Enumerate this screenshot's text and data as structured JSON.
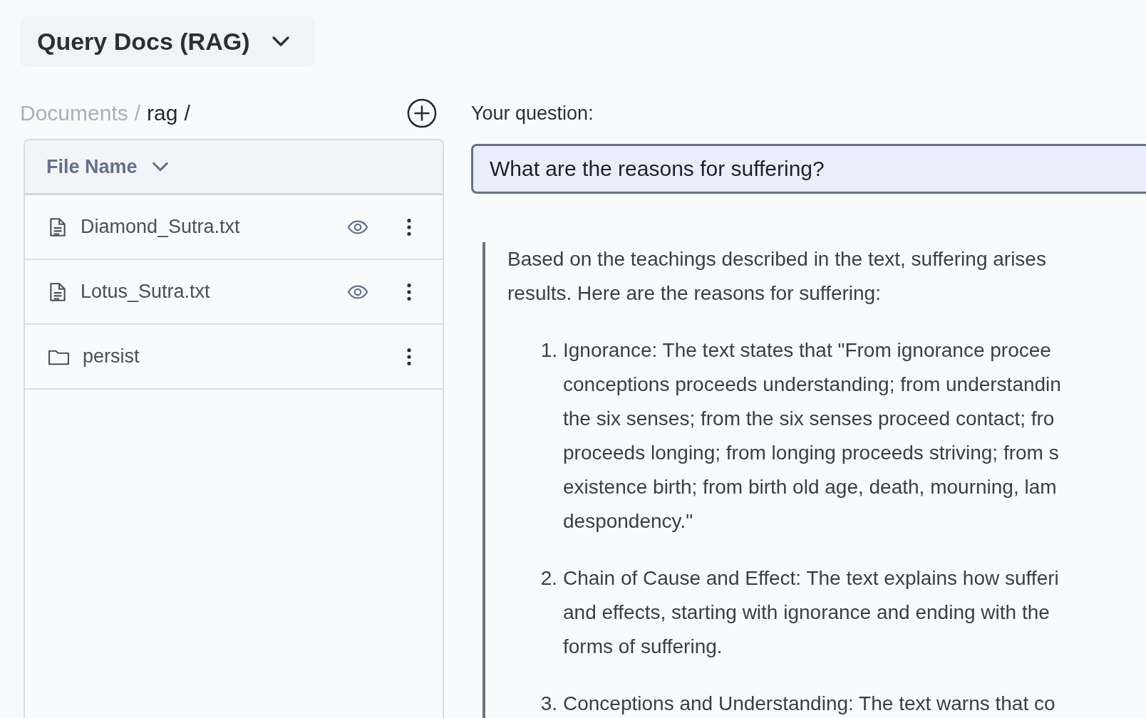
{
  "mode_selector": {
    "label": "Query Docs (RAG)"
  },
  "breadcrumb": {
    "separator": "/",
    "segments": [
      {
        "label": "Documents",
        "current": false
      },
      {
        "label": "rag",
        "current": true
      }
    ]
  },
  "file_table": {
    "column": "File Name",
    "rows": [
      {
        "name": "Diamond_Sutra.txt",
        "kind": "file",
        "previewable": true
      },
      {
        "name": "Lotus_Sutra.txt",
        "kind": "file",
        "previewable": true
      },
      {
        "name": "persist",
        "kind": "folder",
        "previewable": false
      }
    ]
  },
  "question": {
    "label": "Your question:",
    "value": "What are the reasons for suffering?"
  },
  "answer": {
    "intro_lines": [
      "Based on the teachings described in the text, suffering arises",
      "results. Here are the reasons for suffering:"
    ],
    "items": [
      {
        "number": "1.",
        "lines": [
          "Ignorance: The text states that \"From ignorance procee",
          "conceptions proceeds understanding; from understandin",
          "the six senses; from the six senses proceed contact; fro",
          "proceeds longing; from longing proceeds striving; from s",
          "existence birth; from birth old age, death, mourning, lam",
          "despondency.\""
        ]
      },
      {
        "number": "2.",
        "lines": [
          "Chain of Cause and Effect: The text explains how sufferi",
          "and effects, starting with ignorance and ending with the",
          "forms of suffering."
        ]
      },
      {
        "number": "3.",
        "lines": [
          "Conceptions and Understanding: The text warns that co"
        ]
      }
    ]
  }
}
